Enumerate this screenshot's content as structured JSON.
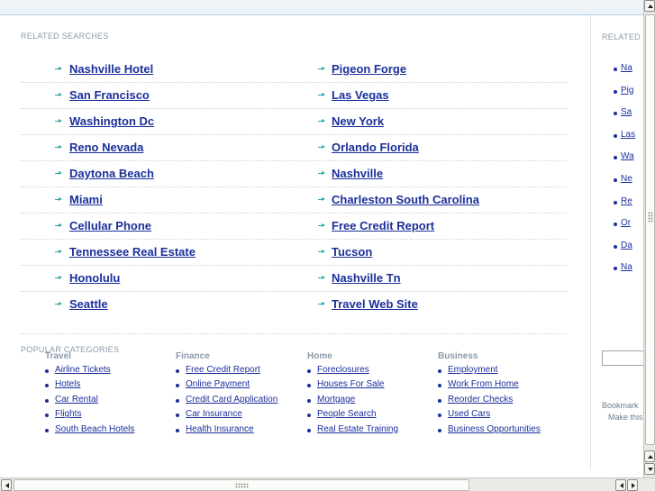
{
  "related_searches": {
    "title": "RELATED SEARCHES",
    "left": [
      "Nashville Hotel",
      "San Francisco",
      "Washington Dc",
      "Reno Nevada",
      "Daytona Beach",
      "Miami",
      "Cellular Phone",
      "Tennessee Real Estate",
      "Honolulu",
      "Seattle"
    ],
    "right": [
      "Pigeon Forge",
      "Las Vegas",
      "New York",
      "Orlando Florida",
      "Nashville",
      "Charleston South Carolina",
      "Free Credit Report",
      "Tucson",
      "Nashville Tn",
      "Travel Web Site"
    ]
  },
  "popular_categories": {
    "title": "POPULAR CATEGORIES",
    "columns": [
      {
        "heading": "Travel",
        "links": [
          "Airline Tickets",
          "Hotels",
          "Car Rental",
          "Flights",
          "South Beach Hotels"
        ]
      },
      {
        "heading": "Finance",
        "links": [
          "Free Credit Report",
          "Online Payment",
          "Credit Card Application",
          "Car Insurance",
          "Health Insurance"
        ]
      },
      {
        "heading": "Home",
        "links": [
          "Foreclosures",
          "Houses For Sale",
          "Mortgage",
          "People Search",
          "Real Estate Training"
        ]
      },
      {
        "heading": "Business",
        "links": [
          "Employment",
          "Work From Home",
          "Reorder Checks",
          "Used Cars",
          "Business Opportunities"
        ]
      }
    ]
  },
  "sidebar": {
    "title": "RELATED",
    "links": [
      "Na",
      "Pig",
      "Sa",
      "Las",
      "Wa",
      "Ne",
      "Re",
      "Or",
      "Da",
      "Na"
    ],
    "bookmark_line1": "Bookmark",
    "bookmark_line2": "Make this"
  },
  "colors": {
    "link": "#1b2f9a",
    "arrow": "#28a7a3",
    "label": "#8a9aaa"
  },
  "icons": {
    "scroll_up": "triangle-up-icon",
    "scroll_down": "triangle-down-icon",
    "scroll_left": "triangle-left-icon",
    "scroll_right": "triangle-right-icon"
  }
}
